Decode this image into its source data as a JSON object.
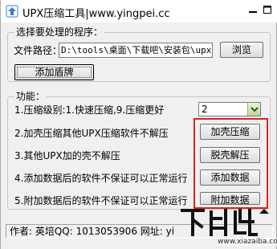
{
  "window": {
    "title": "UPX压缩工具|www.yingpei.cc"
  },
  "select_group": {
    "legend": "选择要处理的程序：",
    "path_label": "文件路径：",
    "path_value": "D:\\tools\\桌面\\下载吧\\安装包\\upx",
    "browse_label": "浏览",
    "add_shell_label": "添加盾牌"
  },
  "function_group": {
    "legend": "功能：",
    "compress_level_text": "1.压缩级别:1.快速压缩,9.压缩更好",
    "compress_level_value": "2",
    "lines": [
      "2.加壳压缩其他UPX压缩软件不解压",
      "3.其他UPX加的壳不解压",
      "4.添加数据后的软件不保证可以正常运行",
      "5.附加数据后的软件不保证可以正常运行"
    ],
    "buttons": [
      "加壳压缩",
      "脱壳解压",
      "添加数据",
      "附加数据"
    ]
  },
  "status_bar": {
    "text": "作者: 英培QQ: 1013053906 网址: yi"
  },
  "watermark": {
    "logo_text": "下载吧",
    "url": "www.xiazaiba.com"
  },
  "colors": {
    "highlight_frame": "#e02020"
  },
  "icons": {
    "app": "upx-app-icon",
    "minimize": "minimize-icon",
    "maximize": "maximize-icon",
    "dropdown": "chevron-down-icon"
  }
}
